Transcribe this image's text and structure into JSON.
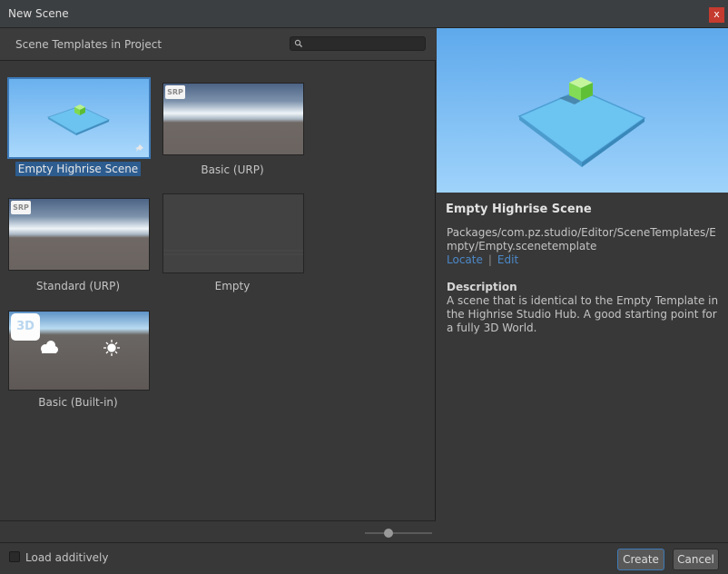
{
  "window": {
    "title": "New Scene",
    "close_label": "x"
  },
  "templates_panel": {
    "title": "Scene Templates in Project",
    "search": {
      "value": "",
      "placeholder": ""
    },
    "tiles": [
      {
        "label": "Empty Highrise Scene",
        "badge": "",
        "pinned": true,
        "selected": true
      },
      {
        "label": "Basic (URP)",
        "badge": "SRP"
      },
      {
        "label": "Standard (URP)",
        "badge": "SRP"
      },
      {
        "label": "Empty",
        "badge": ""
      },
      {
        "label": "Basic (Built-in)",
        "badge": "3D"
      }
    ],
    "zoom_level": 0.35
  },
  "details": {
    "title": "Empty Highrise Scene",
    "path": "Packages/com.pz.studio/Editor/SceneTemplates/Empty/Empty.scenetemplate",
    "locate_label": "Locate",
    "separator": "|",
    "edit_label": "Edit",
    "description_heading": "Description",
    "description": "A scene that is identical to the Empty Template in the Highrise Studio Hub.  A good starting point for a fully 3D World."
  },
  "footer": {
    "load_additively_label": "Load additively",
    "load_additively_checked": false,
    "create_label": "Create",
    "cancel_label": "Cancel"
  },
  "colors": {
    "accent": "#3d7ab8",
    "close": "#c53b2f",
    "link": "#4c88c8"
  }
}
